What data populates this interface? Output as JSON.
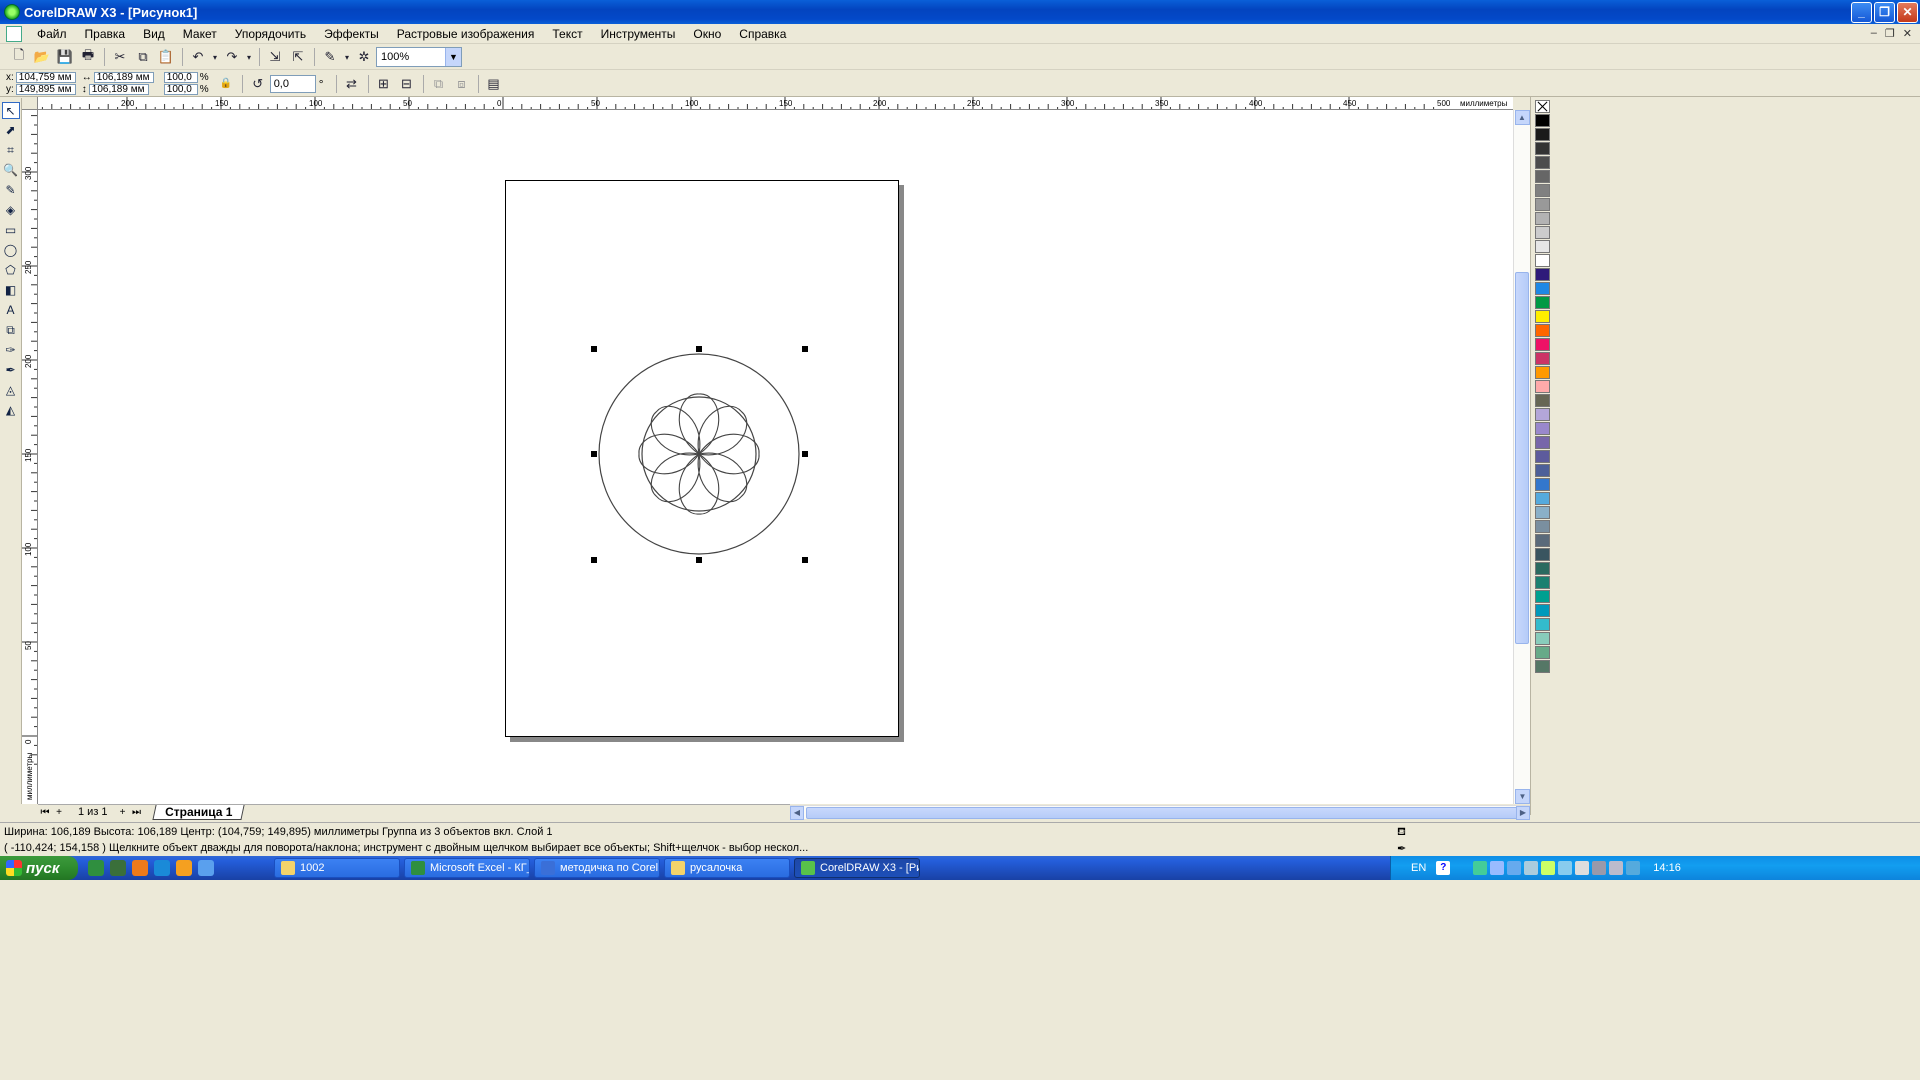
{
  "window": {
    "title": "CorelDRAW X3 - [Рисунок1]",
    "buttons": [
      "_",
      "❐",
      "✕"
    ]
  },
  "menu": {
    "items": [
      "Файл",
      "Правка",
      "Вид",
      "Макет",
      "Упорядочить",
      "Эффекты",
      "Растровые изображения",
      "Текст",
      "Инструменты",
      "Окно",
      "Справка"
    ]
  },
  "toolbar": {
    "zoom_value": "100%"
  },
  "property_bar": {
    "x_label": "x:",
    "x_value": "104,759 мм",
    "y_label": "y:",
    "y_value": "149,895 мм",
    "width_value": "106,189 мм",
    "height_value": "106,189 мм",
    "scale_x": "100,0",
    "scale_y": "100,0",
    "percent": "%",
    "rotation_value": "0,0",
    "degree": "°"
  },
  "rulers": {
    "units_label": "миллиметры",
    "h_ticks": [
      "200",
      "150",
      "100",
      "50",
      "0",
      "50",
      "100",
      "150",
      "200",
      "250",
      "300",
      "350",
      "400",
      "450",
      "500"
    ],
    "v_ticks": [
      "300",
      "250",
      "200",
      "150",
      "100",
      "50",
      "0"
    ]
  },
  "doc_nav": {
    "page_count": "1 из 1",
    "page_tab": "Страница 1"
  },
  "status": {
    "line1": "Ширина: 106,189  Высота: 106,189  Центр: (104,759; 149,895)  миллиметры      Группа из 3 объектов вкл. Слой 1",
    "line2": "( -110,424; 154,158 )   Щелкните объект дважды для поворота/наклона; инструмент с двойным щелчком выбирает все объекты; Shift+щелчок - выбор нескол..."
  },
  "taskbar": {
    "start_label": "пуск",
    "tasks": [
      {
        "label": "1002",
        "icon_color": "#f3d36b"
      },
      {
        "label": "Microsoft Excel - КГ_...",
        "icon_color": "#2f8f3f"
      },
      {
        "label": "методичка по Corel...",
        "icon_color": "#3a6fd8"
      },
      {
        "label": "русалочка",
        "icon_color": "#f3d36b"
      },
      {
        "label": "CorelDRAW X3 - [Рис...",
        "icon_color": "#58c24a"
      }
    ],
    "lang": "EN",
    "clock": "14:16"
  },
  "palette": {
    "colors": [
      "none",
      "#000000",
      "#1a1a1a",
      "#333333",
      "#4d4d4d",
      "#666666",
      "#808080",
      "#999999",
      "#b3b3b3",
      "#cccccc",
      "#e6e6e6",
      "#ffffff",
      "#2e1a7a",
      "#1e88e5",
      "#009944",
      "#ffee00",
      "#ff6600",
      "#ee1166",
      "#cc3366",
      "#ff9900",
      "#ffaaaa",
      "#666655",
      "#b3a6d9",
      "#9988cc",
      "#7766aa",
      "#5d5b9c",
      "#4d6099",
      "#3377cc",
      "#55aadd",
      "#8ab0c8",
      "#7a8fa0",
      "#5a6a7a",
      "#3a5560",
      "#2a6a60",
      "#1b8070",
      "#00a090",
      "#0099bb",
      "#33bbcc",
      "#88ccbb",
      "#66aa88",
      "#557766"
    ]
  }
}
